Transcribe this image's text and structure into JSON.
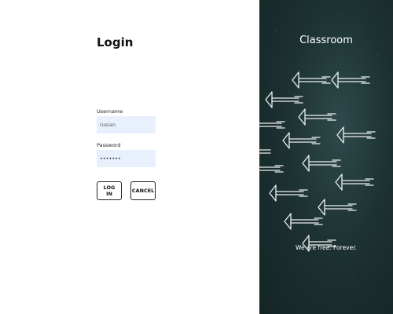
{
  "login": {
    "title": "Login",
    "username_label": "Username",
    "username_value": "rusian",
    "password_label": "Password",
    "password_value": "•••••••",
    "login_button": "LOG IN",
    "cancel_button": "CANCEL"
  },
  "side_panel": {
    "title": "Classroom",
    "tagline": "We are free. Forever."
  },
  "colors": {
    "input_background": "#e8f0fe",
    "chalkboard": "#1d3233",
    "chalk": "#ffffff"
  }
}
